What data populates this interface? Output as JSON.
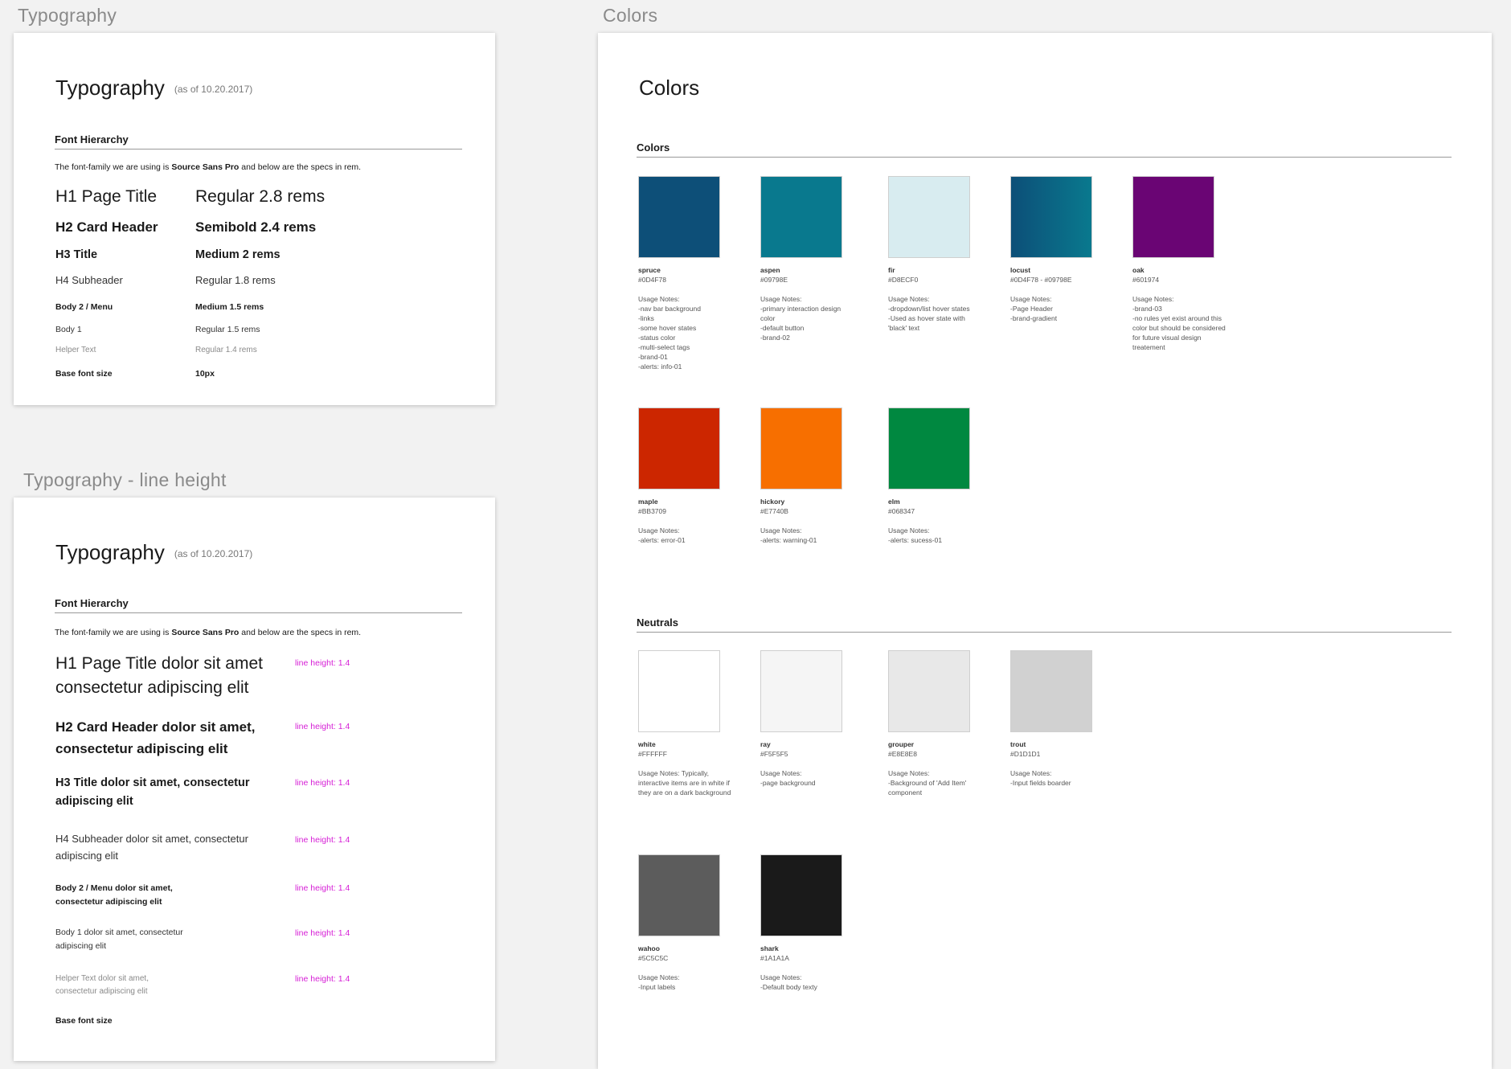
{
  "artboards": {
    "typography": {
      "label": "Typography",
      "title": "Typography",
      "date": "(as of 10.20.2017)",
      "section": "Font Hierarchy",
      "intro_pre": "The font-family we are using is ",
      "intro_font": "Source Sans Pro",
      "intro_post": " and below are the specs in rem.",
      "rows": [
        {
          "name": "H1 Page Title",
          "spec": "Regular 2.8 rems"
        },
        {
          "name": "H2 Card Header",
          "spec": "Semibold 2.4 rems"
        },
        {
          "name": "H3 Title",
          "spec": "Medium 2 rems"
        },
        {
          "name": "H4 Subheader",
          "spec": "Regular 1.8 rems"
        },
        {
          "name": "Body 2 / Menu",
          "spec": "Medium 1.5 rems"
        },
        {
          "name": "Body 1",
          "spec": "Regular 1.5 rems"
        },
        {
          "name": "Helper Text",
          "spec": "Regular 1.4 rems"
        },
        {
          "name": "Base font size",
          "spec": "10px"
        }
      ]
    },
    "typography_lh": {
      "label": "Typography - line height",
      "title": "Typography",
      "date": "(as of 10.20.2017)",
      "section": "Font Hierarchy",
      "intro_pre": "The font-family we are using is ",
      "intro_font": "Source Sans Pro",
      "intro_post": " and below are the specs in rem.",
      "rows": [
        {
          "text": "H1 Page Title dolor sit amet consectetur adipiscing elit",
          "tag": "line height: 1.4"
        },
        {
          "text": "H2 Card Header dolor sit amet, consectetur adipiscing elit",
          "tag": "line height: 1.4"
        },
        {
          "text": "H3 Title dolor sit amet, consectetur adipiscing elit",
          "tag": "line height: 1.4"
        },
        {
          "text": "H4 Subheader dolor sit amet, consectetur adipiscing elit",
          "tag": "line height: 1.4"
        },
        {
          "text": "Body 2 / Menu dolor sit amet, consectetur adipiscing elit",
          "tag": "line height: 1.4"
        },
        {
          "text": "Body 1 dolor sit amet, consectetur adipiscing elit",
          "tag": "line height: 1.4"
        },
        {
          "text": "Helper Text dolor sit amet, consectetur adipiscing elit",
          "tag": "line height: 1.4"
        }
      ],
      "base": "Base font size"
    },
    "colors": {
      "label": "Colors",
      "title": "Colors",
      "colors_section": "Colors",
      "neutrals_section": "Neutrals",
      "colors": [
        {
          "name": "spruce",
          "hex": "#0D4F78",
          "fill": "#0D4F78",
          "notes": "Usage Notes:\n-nav bar background\n-links\n-some hover states\n-status color\n-multi-select tags\n-brand-01\n-alerts: info-01"
        },
        {
          "name": "aspen",
          "hex": "#09798E",
          "fill": "#09798E",
          "notes": "Usage Notes:\n-primary interaction design color\n-default button\n-brand-02"
        },
        {
          "name": "fir",
          "hex": "#D8ECF0",
          "fill": "#D8ECF0",
          "notes": "Usage Notes:\n-dropdown/list hover states\n-Used as hover state with 'black' text"
        },
        {
          "name": "locust",
          "hex": "#0D4F78 - #09798E",
          "fill": "linear-gradient(90deg,#0D4F78,#09798E)",
          "notes": "Usage Notes:\n-Page Header\n-brand-gradient"
        },
        {
          "name": "oak",
          "hex": "#601974",
          "fill": "#6A0574",
          "notes": "Usage Notes:\n-brand-03\n-no rules yet exist around this color but should be considered for future visual design treatement"
        },
        {
          "name": "maple",
          "hex": "#BB3709",
          "fill": "#CC2600",
          "notes": "Usage Notes:\n-alerts: error-01"
        },
        {
          "name": "hickory",
          "hex": "#E7740B",
          "fill": "#F76F00",
          "notes": "Usage Notes:\n-alerts: warning-01"
        },
        {
          "name": "elm",
          "hex": "#068347",
          "fill": "#008840",
          "notes": "Usage Notes:\n-alerts: sucess-01"
        }
      ],
      "neutrals": [
        {
          "name": "white",
          "hex": "#FFFFFF",
          "fill": "#FFFFFF",
          "notes": "Usage Notes: Typically, interactive items are in white if they are on a dark background"
        },
        {
          "name": "ray",
          "hex": "#F5F5F5",
          "fill": "#F5F5F5",
          "notes": "Usage Notes:\n-page background"
        },
        {
          "name": "grouper",
          "hex": "#E8E8E8",
          "fill": "#E8E8E8",
          "notes": "Usage Notes:\n-Background of 'Add Item' component"
        },
        {
          "name": "trout",
          "hex": "#D1D1D1",
          "fill": "#D1D1D1",
          "notes": "Usage Notes:\n-Input fields boarder"
        },
        {
          "name": "wahoo",
          "hex": "#5C5C5C",
          "fill": "#5C5C5C",
          "notes": "Usage Notes:\n-Input labels"
        },
        {
          "name": "shark",
          "hex": "#1A1A1A",
          "fill": "#1A1A1A",
          "notes": "Usage Notes:\n-Default body texty"
        }
      ]
    }
  }
}
